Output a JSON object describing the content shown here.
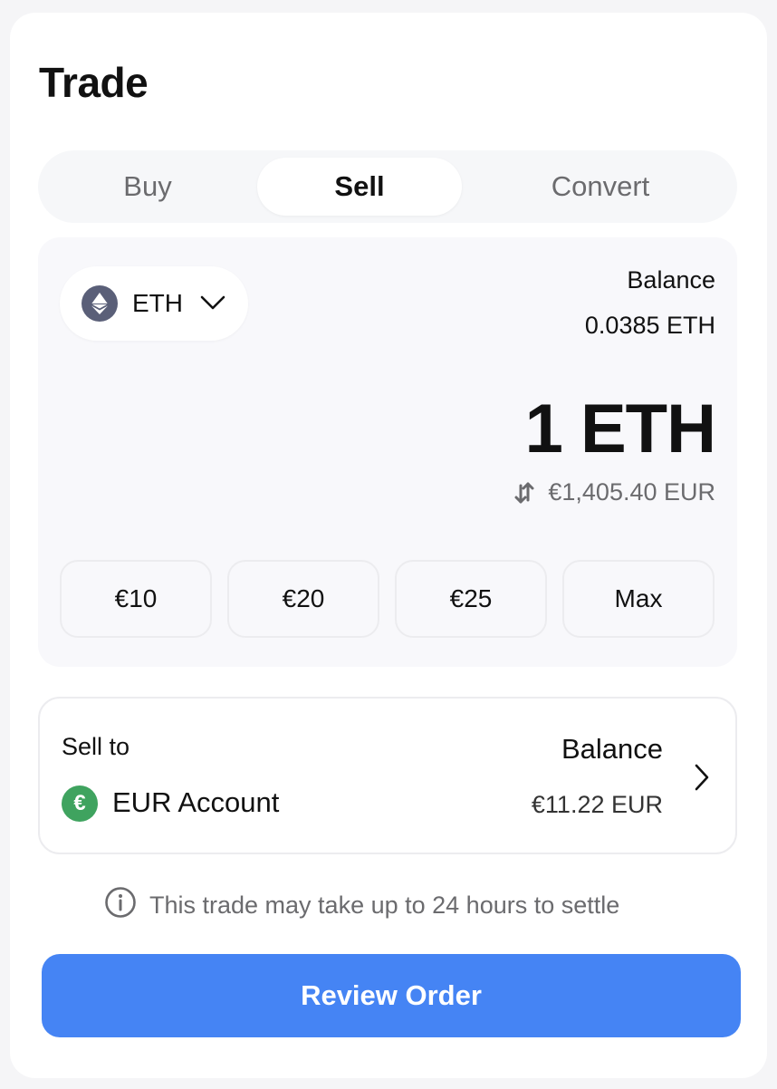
{
  "title": "Trade",
  "tabs": [
    {
      "label": "Buy"
    },
    {
      "label": "Sell"
    },
    {
      "label": "Convert"
    }
  ],
  "coin": {
    "symbol": "ETH",
    "icon": "ethereum-icon"
  },
  "balance": {
    "label": "Balance",
    "value": "0.0385 ETH"
  },
  "amount": "1 ETH",
  "fiat_value": "€1,405.40 EUR",
  "quick_amounts": [
    "€10",
    "€20",
    "€25",
    "Max"
  ],
  "sell_to": {
    "label": "Sell to",
    "account_name": "EUR Account",
    "account_icon": "€",
    "balance_label": "Balance",
    "balance_value": "€11.22 EUR"
  },
  "notice": "This trade may take up to 24 hours to settle",
  "review_label": "Review Order",
  "colors": {
    "accent": "#4584f4",
    "eur_green": "#3fa35f",
    "eth_icon": "#5a5f78"
  }
}
